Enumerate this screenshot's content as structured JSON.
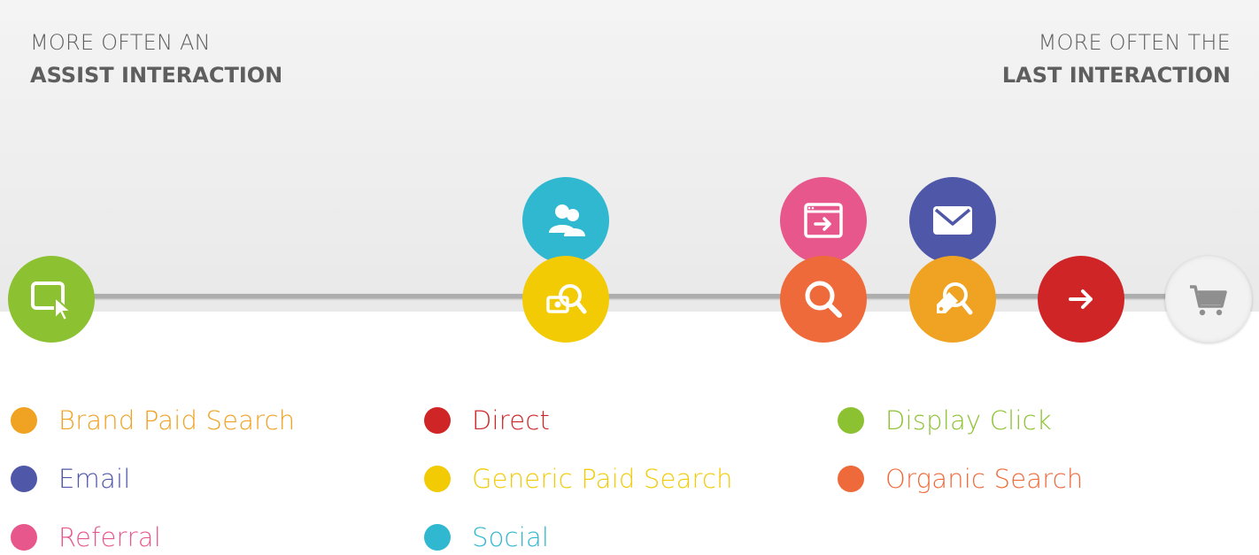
{
  "header": {
    "left_line1": "MORE OFTEN AN",
    "left_line2": "ASSIST INTERACTION",
    "right_line1": "MORE OFTEN THE",
    "right_line2": "LAST INTERACTION"
  },
  "colors": {
    "display_click": "#8cc232",
    "social": "#2fb8cf",
    "generic_paid_search": "#f2cb05",
    "referral": "#e8578c",
    "organic_search": "#ef6a3a",
    "email": "#4f57a8",
    "brand_paid_search": "#f0a222",
    "direct": "#cf2527",
    "cart": "#f2f2f2"
  },
  "timeline_nodes": [
    {
      "channel": "Display Click",
      "icon": "cursor-window-icon"
    },
    {
      "channel": "Social",
      "icon": "people-icon"
    },
    {
      "channel": "Generic Paid Search",
      "icon": "money-search-icon"
    },
    {
      "channel": "Referral",
      "icon": "browser-arrow-icon"
    },
    {
      "channel": "Organic Search",
      "icon": "magnifier-icon"
    },
    {
      "channel": "Email",
      "icon": "envelope-icon"
    },
    {
      "channel": "Brand Paid Search",
      "icon": "tag-search-icon"
    },
    {
      "channel": "Direct",
      "icon": "arrow-right-icon"
    },
    {
      "channel": "Conversion",
      "icon": "shopping-cart-icon"
    }
  ],
  "legend": [
    {
      "label": "Brand Paid Search",
      "color": "#f0a222"
    },
    {
      "label": "Direct",
      "color": "#cf2527"
    },
    {
      "label": "Display Click",
      "color": "#8cc232"
    },
    {
      "label": "Email",
      "color": "#4f57a8"
    },
    {
      "label": "Generic Paid Search",
      "color": "#f2cb05"
    },
    {
      "label": "Organic Search",
      "color": "#ef6a3a"
    },
    {
      "label": "Referral",
      "color": "#e8578c"
    },
    {
      "label": "Social",
      "color": "#2fb8cf"
    }
  ]
}
